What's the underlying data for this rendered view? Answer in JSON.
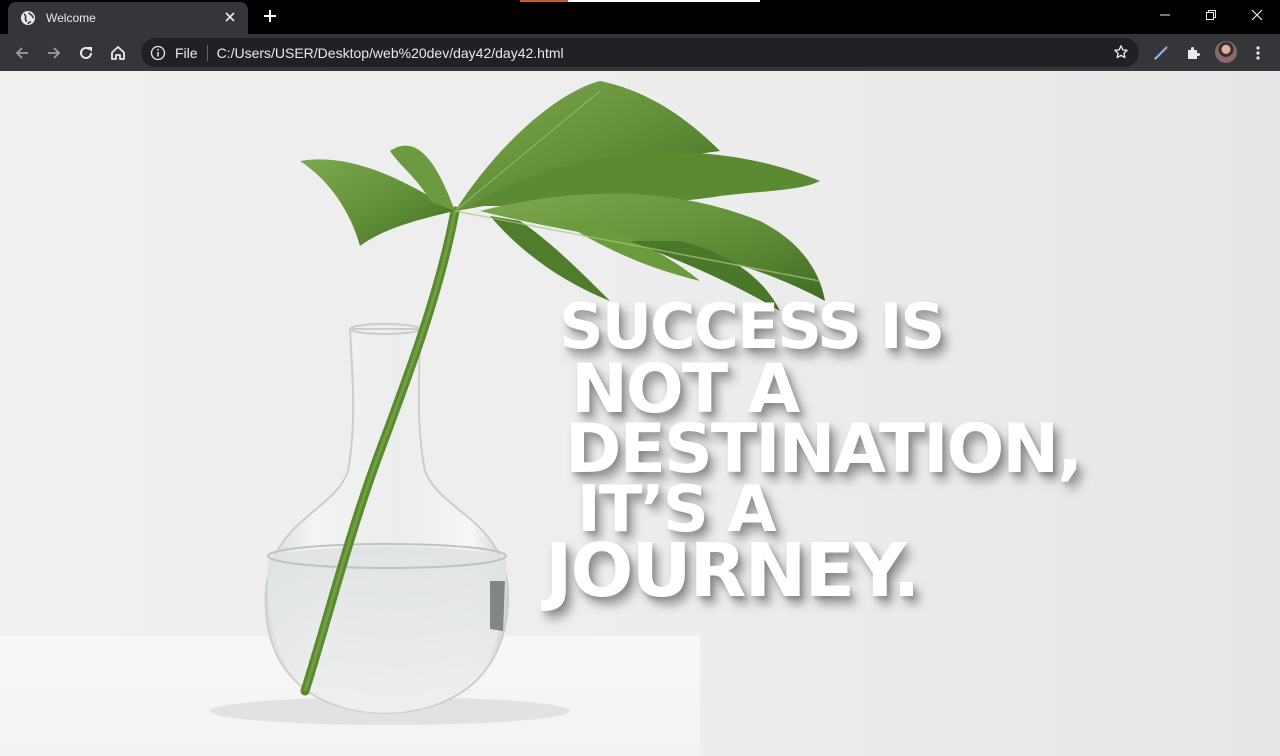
{
  "browser": {
    "tab": {
      "title": "Welcome",
      "favicon": "globe-icon",
      "close_icon": "close-icon"
    },
    "new_tab_icon": "plus-icon",
    "window_controls": [
      "minimize-icon",
      "restore-icon",
      "close-icon"
    ],
    "toolbar": {
      "back_icon": "arrow-left-icon",
      "forward_icon": "arrow-right-icon",
      "reload_icon": "reload-icon",
      "home_icon": "home-icon"
    },
    "omnibox": {
      "info_icon": "info-icon",
      "scheme_label": "File",
      "url": "C:/Users/USER/Desktop/web%20dev/day42/day42.html",
      "bookmark_icon": "star-icon"
    },
    "extensions": [
      "pen-extension-icon",
      "puzzle-icon"
    ],
    "profile": "avatar",
    "menu_icon": "kebab-menu-icon"
  },
  "page": {
    "quote_lines": [
      "Success is",
      "not a",
      "destination,",
      "it’s a",
      "Journey."
    ]
  },
  "colors": {
    "chrome_dark": "#35363a",
    "tabstrip": "#000000",
    "omnibox": "#202124",
    "chrome_text": "#e8eaed",
    "leaf_green": "#5c8a3a",
    "quote_text": "#ffffff"
  }
}
